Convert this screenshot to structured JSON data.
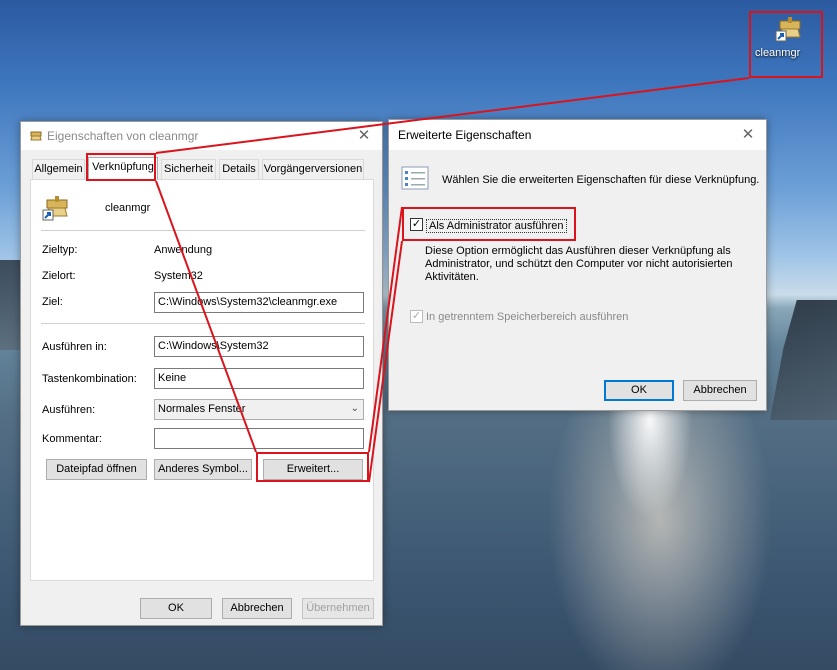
{
  "desktop": {
    "icon_label": "cleanmgr"
  },
  "dialog1": {
    "title": "Eigenschaften von cleanmgr",
    "close_label": "✕",
    "tabs": [
      "Allgemein",
      "Verknüpfung",
      "Sicherheit",
      "Details",
      "Vorgängerversionen"
    ],
    "active_tab": "Verknüpfung",
    "app_name": "cleanmgr",
    "zieltyp_label": "Zieltyp:",
    "zieltyp_value": "Anwendung",
    "zielort_label": "Zielort:",
    "zielort_value": "System32",
    "ziel_label": "Ziel:",
    "ziel_value": "C:\\Windows\\System32\\cleanmgr.exe",
    "ausfuehren_in_label": "Ausführen in:",
    "ausfuehren_in_value": "C:\\Windows\\System32",
    "tasten_label": "Tastenkombination:",
    "tasten_value": "Keine",
    "ausfuehren_label": "Ausführen:",
    "ausfuehren_value": "Normales Fenster",
    "kommentar_label": "Kommentar:",
    "kommentar_value": "",
    "btn_dateipfad": "Dateipfad öffnen",
    "btn_symbol": "Anderes Symbol...",
    "btn_erweitert": "Erweitert...",
    "btn_ok": "OK",
    "btn_abbrechen": "Abbrechen",
    "btn_uebernehmen": "Übernehmen"
  },
  "dialog2": {
    "title": "Erweiterte Eigenschaften",
    "close_label": "✕",
    "intro": "Wählen Sie die erweiterten Eigenschaften für diese Verknüpfung.",
    "admin_label": "Als Administrator ausführen",
    "admin_checked": true,
    "description": "Diese Option ermöglicht das Ausführen dieser Verknüpfung als Administrator, und schützt den Computer vor nicht autorisierten Aktivitäten.",
    "separate_label": "In getrenntem Speicherbereich ausführen",
    "separate_checked": true,
    "btn_ok": "OK",
    "btn_abbrechen": "Abbrechen"
  },
  "colors": {
    "highlight": "#d9141c",
    "focus_blue": "#0078d7"
  },
  "icons": [
    "shortcut-broom-icon",
    "checklist-icon",
    "checkmark-icon",
    "chevron-down-icon",
    "close-icon"
  ]
}
